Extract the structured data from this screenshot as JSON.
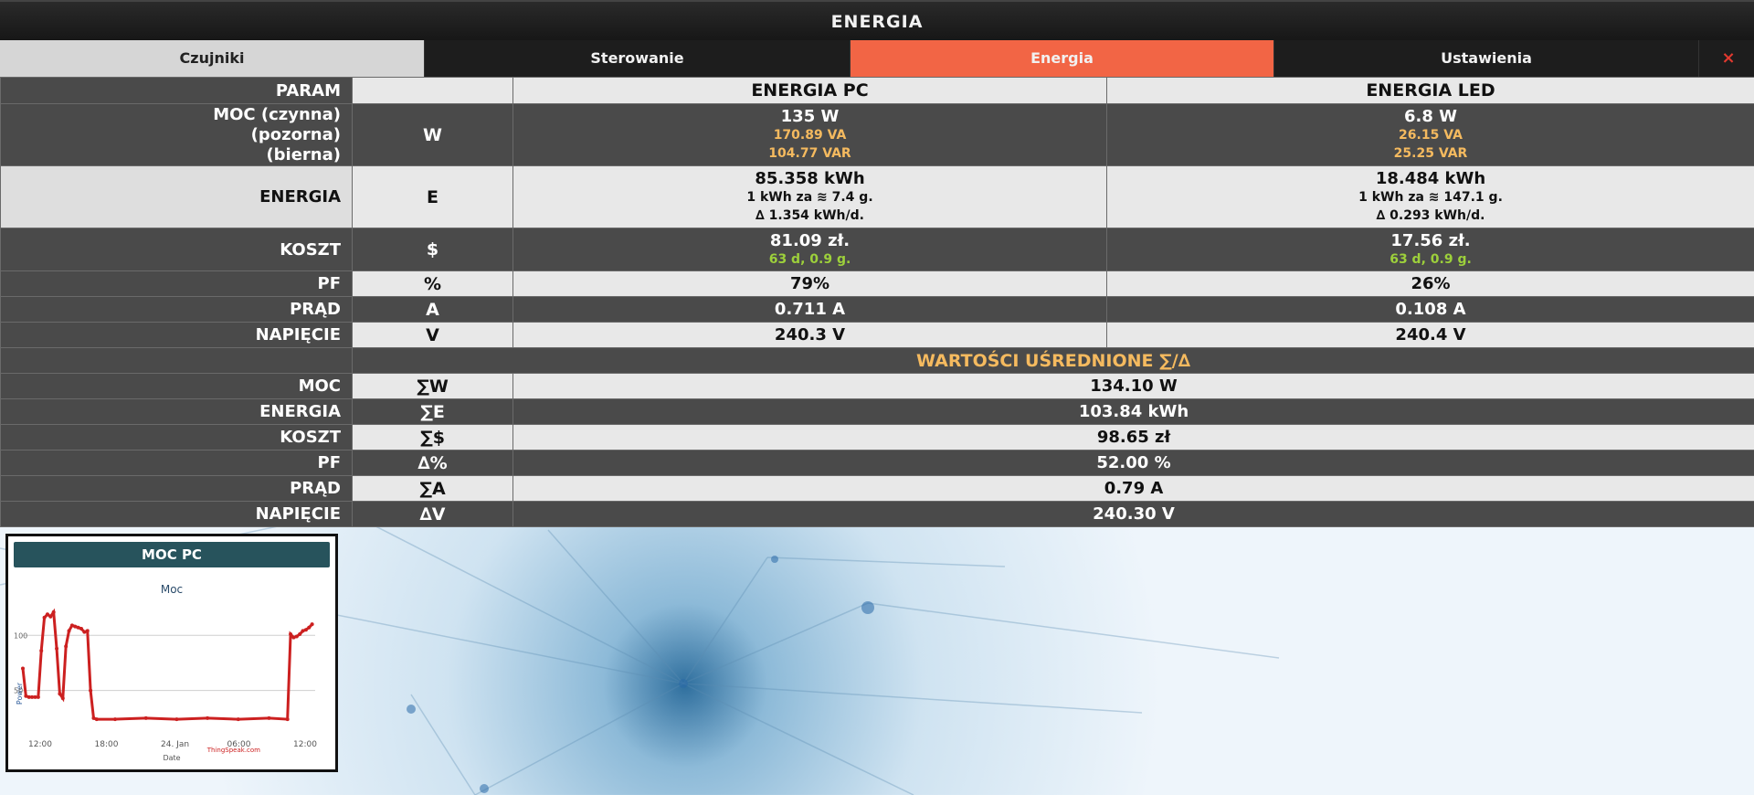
{
  "window": {
    "title": "ENERGIA"
  },
  "tabs": [
    {
      "label": "Czujniki"
    },
    {
      "label": "Sterowanie"
    },
    {
      "label": "Energia",
      "active": true
    },
    {
      "label": "Ustawienia"
    }
  ],
  "close_icon": "×",
  "header": {
    "param": "PARAM",
    "col1": "ENERGIA PC",
    "col2": "ENERGIA LED"
  },
  "rows": {
    "moc": {
      "label1": "MOC (czynna)",
      "label2": "(pozorna)",
      "label3": "(bierna)",
      "unit": "W",
      "pc": {
        "main": "135 W",
        "va": "170.89 VA",
        "var": "104.77 VAR"
      },
      "led": {
        "main": "6.8 W",
        "va": "26.15 VA",
        "var": "25.25 VAR"
      }
    },
    "energia": {
      "label": "ENERGIA",
      "unit": "E",
      "pc": {
        "main": "85.358 kWh",
        "line2": "1 kWh za ≋ 7.4 g.",
        "line3": "∆ 1.354 kWh/d."
      },
      "led": {
        "main": "18.484 kWh",
        "line2": "1 kWh za ≋ 147.1 g.",
        "line3": "∆ 0.293 kWh/d."
      }
    },
    "koszt": {
      "label": "KOSZT",
      "unit": "$",
      "pc": {
        "main": "81.09 zł.",
        "line2": "63 d, 0.9 g."
      },
      "led": {
        "main": "17.56 zł.",
        "line2": "63 d, 0.9 g."
      }
    },
    "pf": {
      "label": "PF",
      "unit": "%",
      "pc": "79%",
      "led": "26%"
    },
    "prad": {
      "label": "PRĄD",
      "unit": "A",
      "pc": "0.711 A",
      "led": "0.108 A"
    },
    "napiecie": {
      "label": "NAPIĘCIE",
      "unit": "V",
      "pc": "240.3 V",
      "led": "240.4 V"
    }
  },
  "averages": {
    "title": "WARTOŚCI UŚREDNIONE ∑/∆",
    "rows": [
      {
        "label": "MOC",
        "unit": "∑W",
        "value": "134.10 W"
      },
      {
        "label": "ENERGIA",
        "unit": "∑E",
        "value": "103.84 kWh"
      },
      {
        "label": "KOSZT",
        "unit": "∑$",
        "value": "98.65 zł"
      },
      {
        "label": "PF",
        "unit": "∆%",
        "value": "52.00 %"
      },
      {
        "label": "PRĄD",
        "unit": "∑A",
        "value": "0.79 A"
      },
      {
        "label": "NAPIĘCIE",
        "unit": "∆V",
        "value": "240.30 V"
      }
    ]
  },
  "chart_widget": {
    "title": "MOC PC"
  },
  "chart_data": {
    "type": "line",
    "title": "Moc",
    "xlabel": "Date",
    "ylabel": "Power",
    "x_ticks": [
      "12:00",
      "18:00",
      "24. Jan",
      "06:00",
      "12:00"
    ],
    "y_ticks": [
      "50",
      "100"
    ],
    "credit": "ThingSpeak.com",
    "color": "#cc2020",
    "series": [
      {
        "values": [
          [
            0,
            70
          ],
          [
            1,
            45
          ],
          [
            2,
            44
          ],
          [
            3,
            44
          ],
          [
            4,
            44
          ],
          [
            5,
            44
          ],
          [
            6,
            86
          ],
          [
            7,
            116
          ],
          [
            8,
            119
          ],
          [
            9,
            117
          ],
          [
            10,
            121
          ],
          [
            11,
            88
          ],
          [
            12,
            47
          ],
          [
            13,
            43
          ],
          [
            14,
            90
          ],
          [
            15,
            104
          ],
          [
            16,
            109
          ],
          [
            17,
            108
          ],
          [
            18,
            107
          ],
          [
            19,
            106
          ],
          [
            20,
            103
          ],
          [
            21,
            104
          ],
          [
            22,
            50
          ],
          [
            23,
            25
          ],
          [
            24,
            24
          ],
          [
            30,
            24
          ],
          [
            40,
            25
          ],
          [
            50,
            24
          ],
          [
            60,
            25
          ],
          [
            70,
            24
          ],
          [
            80,
            25
          ],
          [
            86,
            24
          ],
          [
            87,
            101
          ],
          [
            88,
            98
          ],
          [
            89,
            99
          ],
          [
            90,
            101
          ],
          [
            91,
            104
          ],
          [
            92,
            105
          ],
          [
            93,
            107
          ],
          [
            94,
            110
          ]
        ]
      }
    ],
    "xlim": [
      0,
      95
    ],
    "ylim": [
      10,
      130
    ]
  }
}
